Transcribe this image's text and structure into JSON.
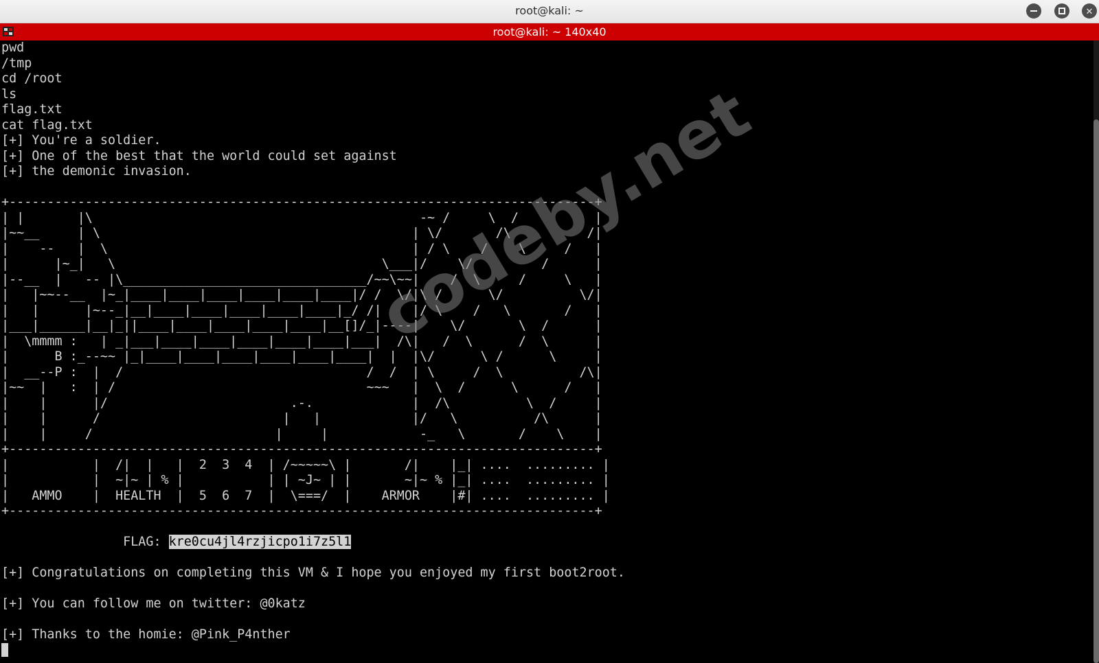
{
  "window": {
    "title": "root@kali: ~",
    "icons": [
      "minimize-icon",
      "maximize-icon",
      "close-icon"
    ]
  },
  "tab": {
    "title": "root@kali: ~ 140x40",
    "icon": "terminal-icon"
  },
  "terminal": {
    "lines": [
      "pwd",
      "/tmp",
      "cd /root",
      "ls",
      "flag.txt",
      "cat flag.txt",
      "[+] You're a soldier.",
      "[+] One of the best that the world could set against",
      "[+] the demonic invasion.",
      "",
      "+-----------------------------------------------------------------------------+",
      "| |       |\\                                           -~ /     \\  /          |",
      "|~~__     | \\                                         | \\/       /\\          /|",
      "|    --   |  \\                                        | / \\    /    \\     /   |",
      "|      |~_|   \\                                   \\___|/    \\/         /      |",
      "|--__  |   -- |\\________________________________/~~\\~~|    /  \\     /     \\   |",
      "|   |~~--__  |~_|____|____|____|____|____|____|/ /  \\/|\\ /      \\/          \\/|",
      "|   |      |~--_|__|____|____|____|____|____|_/ /|    |/ \\    /   \\       /   |",
      "|___|______|__|_||____|____|____|____|____|__[]/_|----|    \\/       \\  /      |",
      "|  \\mmmm :   | _|___|____|____|____|____|____|___|  /\\|   /  \\      /  \\      |",
      "|      B :_--~~ |_|____|____|____|____|____|____|  |  |\\/      \\ /      \\     |",
      "|  __--P :  |  /                                /  /  | \\     /  \\          /\\|",
      "|~~  |   :  | /                                 ~~~   |  \\  /      \\      /   |",
      "|    |      |/                        .-.             |  /\\          \\  /     |",
      "|    |      /                        |   |            |/   \\          /\\      |",
      "|    |     /                        |     |            -_   \\       /    \\    |",
      "+-----------------------------------------------------------------------------+",
      "|           |  /|  |   |  2  3  4  | /~~~~~\\ |       /|    |_| ....  ......... |",
      "|           |  ~|~ | % |           | | ~J~ | |       ~|~ % |_| ....  ......... |",
      "|   AMMO    |  HEALTH  |  5  6  7  |  \\===/  |    ARMOR    |#| ....  ......... |",
      "+-----------------------------------------------------------------------------+",
      ""
    ],
    "flag_prefix": "                FLAG: ",
    "flag_value": "kre0cu4jl4rzjicpo1i7z5l1",
    "after_lines": [
      "",
      "[+] Congratulations on completing this VM & I hope you enjoyed my first boot2root.",
      "",
      "[+] You can follow me on twitter: @0katz",
      "",
      "[+] Thanks to the homie: @Pink_P4nther"
    ],
    "colors": {
      "background": "#000000",
      "foreground": "#d3d3d3",
      "tabbar": "#cc0000"
    }
  },
  "watermark": "codeby.net"
}
